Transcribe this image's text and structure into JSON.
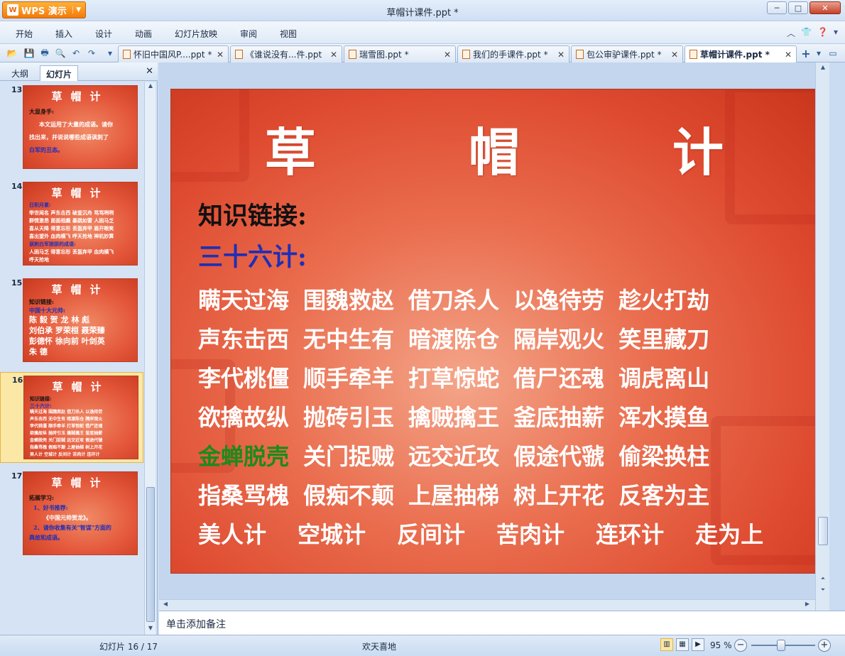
{
  "app": {
    "name": "WPS 演示",
    "window_title": "草帽计课件.ppt *"
  },
  "menu": [
    "开始",
    "插入",
    "设计",
    "动画",
    "幻灯片放映",
    "审阅",
    "视图"
  ],
  "tabs": [
    {
      "label": "怀旧中国风P....ppt *"
    },
    {
      "label": "《谁说没有...件.ppt"
    },
    {
      "label": "瑞雪图.ppt *"
    },
    {
      "label": "我们的手课件.ppt *"
    },
    {
      "label": "包公审驴课件.ppt *"
    },
    {
      "label": "草帽计课件.ppt *"
    }
  ],
  "left_panel": {
    "tab_outline": "大纲",
    "tab_slides": "幻灯片",
    "thumbnails": [
      {
        "num": "13",
        "title": "草帽计",
        "lines": [
          "大显身手:",
          "本文运用了大量的成语。请你",
          "找出来，并说说哪些成语讽刺了",
          "白军的丑态。"
        ]
      },
      {
        "num": "14",
        "title": "草帽计",
        "lines": [
          "日积月累:",
          "举世闻名  声东击西  破釜沉舟  骂骂咧咧",
          "群情激昂  面面相觑  暴跳如雷  人困马乏",
          "喜从天降  得意忘形  丢盔弃甲  眉开眼笑",
          "喜出望外  血肉横飞  呼天抢地  神机妙算",
          "讽刺白军狼狈的成语:",
          "人困马乏  得意忘形  丢盔弃甲  血肉横飞",
          "呼天抢地"
        ]
      },
      {
        "num": "15",
        "title": "草帽计",
        "lines": [
          "知识链接:",
          "中国十大元帅:",
          "陈 毅  贺 龙  林 彪",
          "刘伯承  罗荣桓  聂荣臻",
          "彭德怀  徐向前  叶剑英",
          "朱 德"
        ]
      },
      {
        "num": "16",
        "title": "草帽计",
        "lines": [
          "知识链接:",
          "三十六计:",
          "瞒天过海 围魏救赵 借刀杀人 以逸待劳",
          "声东击西 无中生有 暗渡陈仓 隔岸观火",
          "李代桃僵 顺手牵羊 打草惊蛇 借尸还魂",
          "欲擒故纵 抛砖引玉 擒贼擒王 釜底抽薪",
          "金蝉脱壳 关门捉贼 远交近攻 假途代虢",
          "指桑骂槐 假痴不颠 上屋抽梯 树上开花",
          "美人计 空城计 反间计 苦肉计 连环计"
        ]
      },
      {
        "num": "17",
        "title": "草帽计",
        "lines": [
          "拓展学习:",
          "1、好书推荐:",
          "《中国元帅贺龙》。",
          "2、请你收集有关\"智谋\"方面的",
          "典故和成语。"
        ]
      }
    ]
  },
  "slide": {
    "title": "草 帽 计",
    "heading": "知识链接:",
    "subheading": "三十六计:",
    "rows": [
      [
        "瞒天过海",
        "围魏救赵",
        "借刀杀人",
        "以逸待劳",
        "趁火打劫"
      ],
      [
        "声东击西",
        "无中生有",
        "暗渡陈仓",
        "隔岸观火",
        "笑里藏刀"
      ],
      [
        "李代桃僵",
        "顺手牵羊",
        "打草惊蛇",
        "借尸还魂",
        "调虎离山"
      ],
      [
        "欲擒故纵",
        "抛砖引玉",
        "擒贼擒王",
        "釜底抽薪",
        "浑水摸鱼"
      ],
      [
        "金蝉脱壳",
        "关门捉贼",
        "远交近攻",
        "假途代虢",
        "偷梁换柱"
      ],
      [
        "指桑骂槐",
        "假痴不颠",
        "上屋抽梯",
        "树上开花",
        "反客为主"
      ],
      [
        "美人计",
        "空城计",
        "反间计",
        "苦肉计",
        "连环计",
        "走为上"
      ]
    ]
  },
  "notes_placeholder": "单击添加备注",
  "status": {
    "slide_counter": "幻灯片 16 / 17",
    "theme_name": "欢天喜地",
    "zoom": "95 %"
  },
  "colors": {
    "slide_bg": "#e4573a",
    "heading_text": "#111111",
    "sub_text": "#1d2fb8",
    "highlight_text": "#1b8b1b",
    "accent": "#f27a0c"
  }
}
